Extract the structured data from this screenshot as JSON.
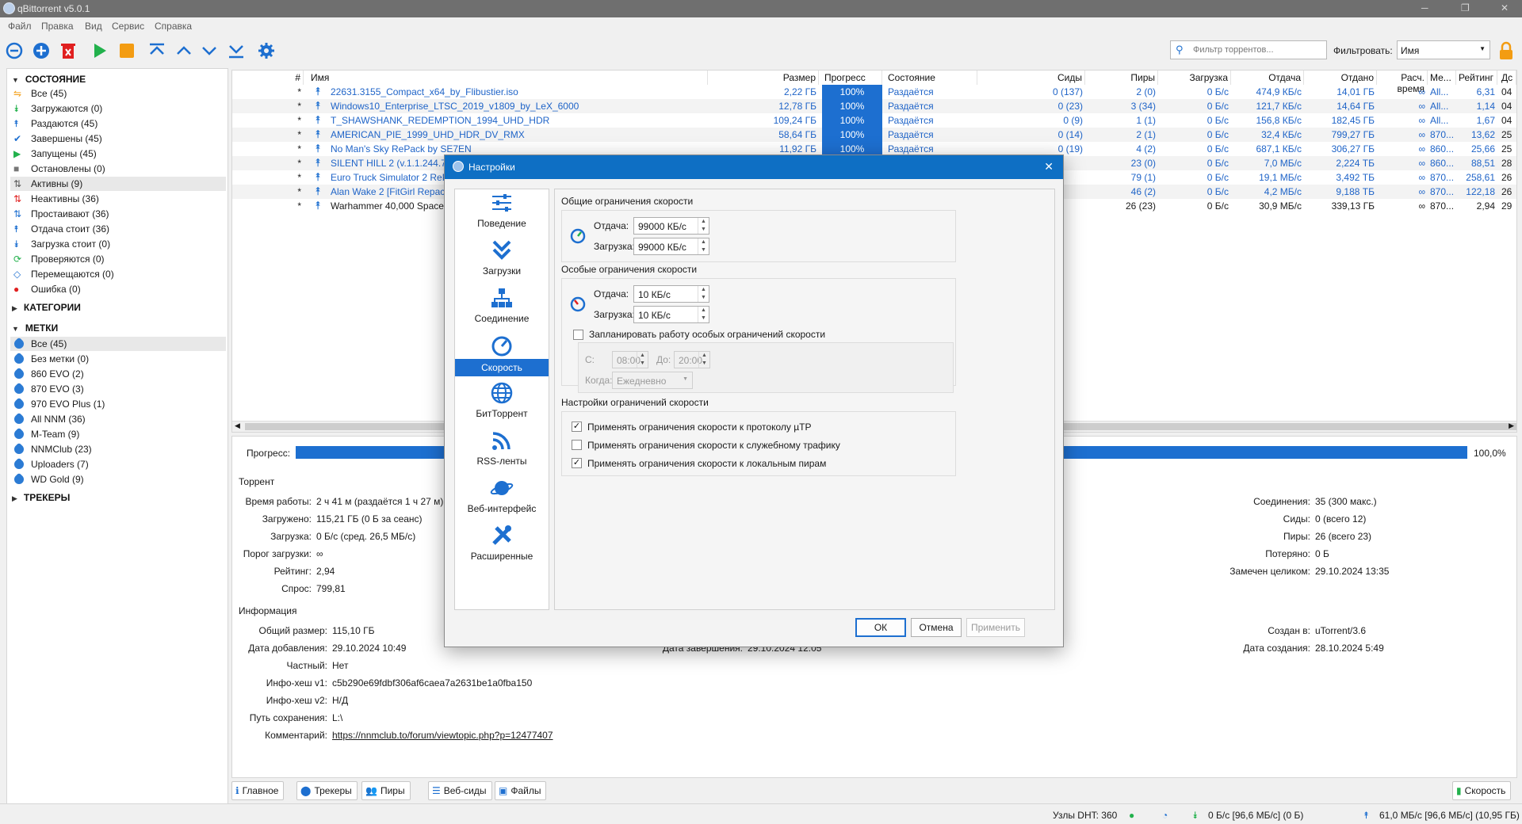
{
  "window": {
    "title": "qBittorrent v5.0.1"
  },
  "menu": [
    "Файл",
    "Правка",
    "Вид",
    "Сервис",
    "Справка"
  ],
  "search": {
    "placeholder": "Фильтр торрентов...",
    "filter_label": "Фильтровать:",
    "filter_value": "Имя"
  },
  "sidebar": {
    "status_header": "СОСТОЯНИЕ",
    "status": [
      {
        "label": "Все (45)",
        "icon": "filter-all-icon"
      },
      {
        "label": "Загружаются (0)",
        "icon": "downloading-icon"
      },
      {
        "label": "Раздаются (45)",
        "icon": "seeding-icon"
      },
      {
        "label": "Завершены (45)",
        "icon": "completed-icon"
      },
      {
        "label": "Запущены (45)",
        "icon": "running-icon"
      },
      {
        "label": "Остановлены (0)",
        "icon": "stopped-icon"
      },
      {
        "label": "Активны (9)",
        "icon": "active-icon"
      },
      {
        "label": "Неактивны (36)",
        "icon": "inactive-icon"
      },
      {
        "label": "Простаивают (36)",
        "icon": "stalled-icon"
      },
      {
        "label": "Отдача стоит (36)",
        "icon": "stalled-upload-icon"
      },
      {
        "label": "Загрузка стоит (0)",
        "icon": "stalled-download-icon"
      },
      {
        "label": "Проверяются (0)",
        "icon": "checking-icon"
      },
      {
        "label": "Перемещаются (0)",
        "icon": "moving-icon"
      },
      {
        "label": "Ошибка (0)",
        "icon": "error-icon"
      }
    ],
    "categories_header": "КАТЕГОРИИ",
    "tags_header": "МЕТКИ",
    "tags": [
      "Все (45)",
      "Без метки (0)",
      "860 EVO (2)",
      "870 EVO (3)",
      "970 EVO Plus (1)",
      "All NNM (36)",
      "M-Team (9)",
      "NNMClub (23)",
      "Uploaders (7)",
      "WD Gold (9)"
    ],
    "trackers_header": "ТРЕКЕРЫ"
  },
  "columns": [
    "#",
    "Имя",
    "Размер",
    "Прогресс",
    "Состояние",
    "Сиды",
    "Пиры",
    "Загрузка",
    "Отдача",
    "Отдано",
    "Расч. время",
    "Ме...",
    "Рейтинг",
    "Дс"
  ],
  "torrents": [
    {
      "num": "*",
      "name": "22631.3155_Compact_x64_by_Flibustier.iso",
      "size": "2,22 ГБ",
      "progress": "100%",
      "state": "Раздаётся",
      "seeds": "0 (137)",
      "peers": "2 (0)",
      "down": "0 Б/с",
      "up": "474,9 КБ/с",
      "uploaded": "14,01 ГБ",
      "eta": "∞",
      "tracker": "All...",
      "ratio": "6,31",
      "extra": "04"
    },
    {
      "num": "*",
      "name": "Windows10_Enterprise_LTSC_2019_v1809_by_LeX_6000",
      "size": "12,78 ГБ",
      "progress": "100%",
      "state": "Раздаётся",
      "seeds": "0 (23)",
      "peers": "3 (34)",
      "down": "0 Б/с",
      "up": "121,7 КБ/с",
      "uploaded": "14,64 ГБ",
      "eta": "∞",
      "tracker": "All...",
      "ratio": "1,14",
      "extra": "04"
    },
    {
      "num": "*",
      "name": "T_SHAWSHANK_REDEMPTION_1994_UHD_HDR",
      "size": "109,24 ГБ",
      "progress": "100%",
      "state": "Раздаётся",
      "seeds": "0 (9)",
      "peers": "1 (1)",
      "down": "0 Б/с",
      "up": "156,8 КБ/с",
      "uploaded": "182,45 ГБ",
      "eta": "∞",
      "tracker": "All...",
      "ratio": "1,67",
      "extra": "04"
    },
    {
      "num": "*",
      "name": "AMERICAN_PIE_1999_UHD_HDR_DV_RMX",
      "size": "58,64 ГБ",
      "progress": "100%",
      "state": "Раздаётся",
      "seeds": "0 (14)",
      "peers": "2 (1)",
      "down": "0 Б/с",
      "up": "32,4 КБ/с",
      "uploaded": "799,27 ГБ",
      "eta": "∞",
      "tracker": "870...",
      "ratio": "13,62",
      "extra": "25"
    },
    {
      "num": "*",
      "name": "No Man's Sky RePack by SE7EN",
      "size": "11,92 ГБ",
      "progress": "100%",
      "state": "Раздаётся",
      "seeds": "0 (19)",
      "peers": "4 (2)",
      "down": "0 Б/с",
      "up": "687,1 КБ/с",
      "uploaded": "306,27 ГБ",
      "eta": "∞",
      "tracker": "860...",
      "ratio": "25,66",
      "extra": "25"
    },
    {
      "num": "*",
      "name": "SILENT HILL 2 (v.1.1.244.738",
      "size": "",
      "progress": "",
      "state": "",
      "seeds": "",
      "peers": "23 (0)",
      "down": "0 Б/с",
      "up": "7,0 МБ/с",
      "uploaded": "2,224 ТБ",
      "eta": "∞",
      "tracker": "860...",
      "ratio": "88,51",
      "extra": "28"
    },
    {
      "num": "*",
      "name": "Euro Truck Simulator 2 ReP",
      "size": "",
      "progress": "",
      "state": "",
      "seeds": "",
      "peers": "79 (1)",
      "down": "0 Б/с",
      "up": "19,1 МБ/с",
      "uploaded": "3,492 ТБ",
      "eta": "∞",
      "tracker": "870...",
      "ratio": "258,61",
      "extra": "26"
    },
    {
      "num": "*",
      "name": "Alan Wake 2 [FitGirl Repack",
      "size": "",
      "progress": "",
      "state": "",
      "seeds": "",
      "peers": "46 (2)",
      "down": "0 Б/с",
      "up": "4,2 МБ/с",
      "uploaded": "9,188 ТБ",
      "eta": "∞",
      "tracker": "870...",
      "ratio": "122,18",
      "extra": "26"
    },
    {
      "num": "*",
      "name": "Warhammer 40,000 Space M",
      "size": "",
      "progress": "",
      "state": "",
      "seeds": "",
      "peers": "26 (23)",
      "down": "0 Б/с",
      "up": "30,9 МБ/с",
      "uploaded": "339,13 ГБ",
      "eta": "∞",
      "tracker": "870...",
      "ratio": "2,94",
      "extra": "29"
    }
  ],
  "details": {
    "progress_label": "Прогресс:",
    "progress_value": "100,0%",
    "progress_fraction": 1.0,
    "torrent_header": "Торрент",
    "uptime_label": "Время работы:",
    "uptime": "2 ч 41 м (раздаётся 1 ч 27 м)",
    "downloaded_label": "Загружено:",
    "downloaded": "115,21 ГБ (0 Б за сеанс)",
    "dlspeed_label": "Загрузка:",
    "dlspeed": "0 Б/с (сред. 26,5 МБ/с)",
    "dllimit_label": "Порог загрузки:",
    "dllimit": "∞",
    "ratio_label": "Рейтинг:",
    "ratio": "2,94",
    "popularity_label": "Спрос:",
    "popularity": "799,81",
    "conn_label": "Соединения:",
    "conn": "35 (300 макс.)",
    "seeds_label": "Сиды:",
    "seeds": "0 (всего 12)",
    "peers_label": "Пиры:",
    "peers": "26 (всего 23)",
    "wasted_label": "Потеряно:",
    "wasted": "0 Б",
    "lastseen_label": "Замечен целиком:",
    "lastseen": "29.10.2024 13:35",
    "info_header": "Информация",
    "total_label": "Общий размер:",
    "total": "115,10 ГБ",
    "added_label": "Дата добавления:",
    "added": "29.10.2024 10:49",
    "completed_label": "Дата завершения:",
    "completed": "29.10.2024 12:05",
    "created_by_label": "Создан в:",
    "created_by": "uTorrent/3.6",
    "created_on_label": "Дата создания:",
    "created_on": "28.10.2024 5:49",
    "private_label": "Частный:",
    "private": "Нет",
    "hash1_label": "Инфо-хеш v1:",
    "hash1": "c5b290e69fdbf306af6caea7a2631be1a0fba150",
    "hash2_label": "Инфо-хеш v2:",
    "hash2": "Н/Д",
    "path_label": "Путь сохранения:",
    "path": "L:\\",
    "comment_label": "Комментарий:",
    "comment": "https://nnmclub.to/forum/viewtopic.php?p=12477407"
  },
  "bottom_tabs": [
    "Главное",
    "Трекеры",
    "Пиры",
    "Веб-сиды",
    "Файлы"
  ],
  "speed_tab": "Скорость",
  "statusbar": {
    "dht": "Узлы DHT: 360",
    "down": "0 Б/с [96,6 МБ/с] (0 Б)",
    "up": "61,0 МБ/с [96,6 МБ/с] (10,95 ГБ)"
  },
  "dialog": {
    "title": "Настройки",
    "nav": [
      "Поведение",
      "Загрузки",
      "Соединение",
      "Скорость",
      "БитТоррент",
      "RSS-ленты",
      "Веб-интерфейс",
      "Расширенные"
    ],
    "global_title": "Общие ограничения скорости",
    "upload_label": "Отдача:",
    "global_up": "99000 КБ/с",
    "download_label": "Загрузка:",
    "global_down": "99000 КБ/с",
    "alt_title": "Особые ограничения скорости",
    "alt_up": "10 КБ/с",
    "alt_down": "10 КБ/с",
    "schedule_label": "Запланировать работу особых ограничений скорости",
    "schedule_checked": false,
    "from_label": "С:",
    "from": "08:00",
    "to_label": "До:",
    "to": "20:00",
    "when_label": "Когда:",
    "when": "Ежедневно",
    "settings_title": "Настройки ограничений скорости",
    "opt1": "Применять ограничения скорости к протоколу µTP",
    "opt1_checked": true,
    "opt2": "Применять ограничения скорости к служебному трафику",
    "opt2_checked": false,
    "opt3": "Применять ограничения скорости к локальным пирам",
    "opt3_checked": true,
    "ok": "ОК",
    "cancel": "Отмена",
    "apply": "Применить"
  }
}
